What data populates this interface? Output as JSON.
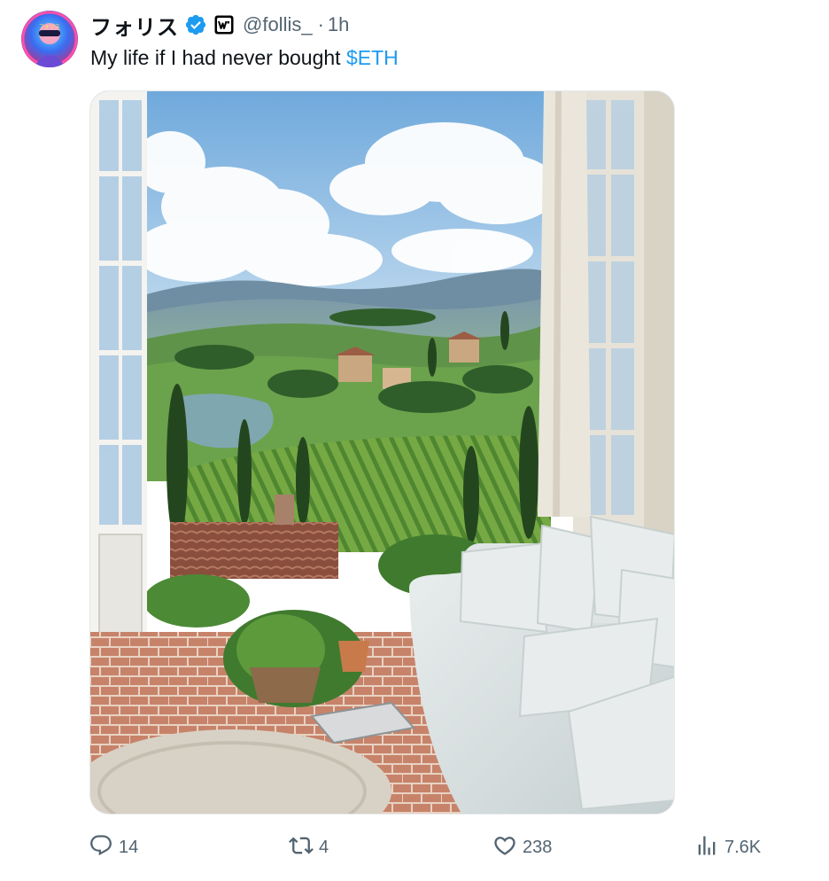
{
  "author": {
    "display_name": "フォリス",
    "handle": "@follis_",
    "verified": true,
    "affiliation_badge": "w-badge-icon"
  },
  "meta": {
    "separator": "·",
    "time": "1h"
  },
  "tweet": {
    "text_prefix": "My life if I had never bought ",
    "cashtag": "$ETH"
  },
  "media": {
    "description_icon": "tuscan-view-photo"
  },
  "actions": {
    "replies": "14",
    "retweets": "4",
    "likes": "238",
    "views": "7.6K"
  },
  "colors": {
    "link": "#1d9bf0",
    "secondary_text": "#536471",
    "primary_text": "#0f1419",
    "verified": "#1d9bf0"
  }
}
